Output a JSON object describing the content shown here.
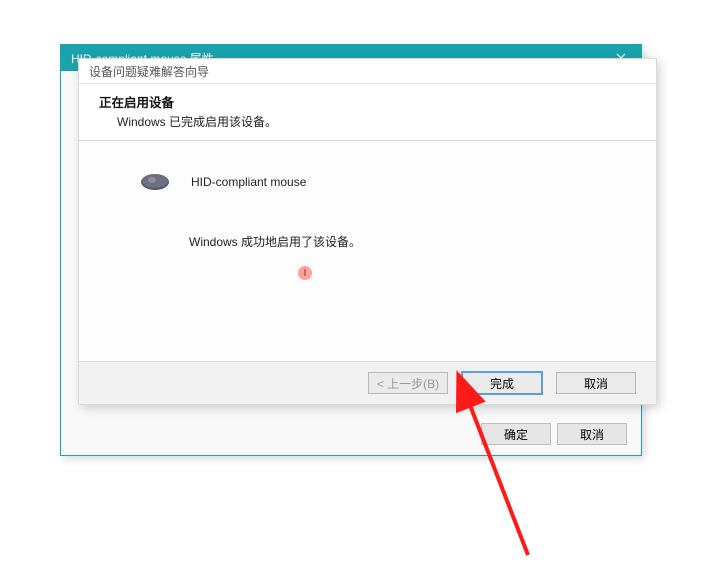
{
  "parent_window": {
    "title": "HID-compliant mouse 属性",
    "ok_label": "确定",
    "cancel_label": "取消"
  },
  "wizard": {
    "title": "设备问题疑难解答向导",
    "header_title": "正在启用设备",
    "header_subtitle": "Windows 已完成启用该设备。",
    "device_name": "HID-compliant mouse",
    "status_text": "Windows 成功地启用了该设备。",
    "back_label": "< 上一步(B)",
    "finish_label": "完成",
    "cancel_label": "取消"
  }
}
